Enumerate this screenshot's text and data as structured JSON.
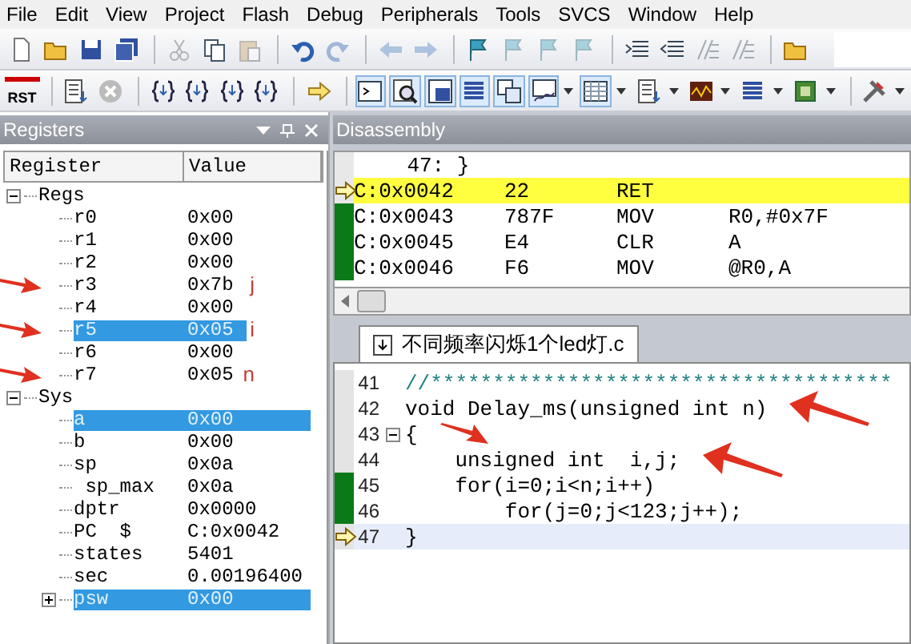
{
  "menu": [
    "File",
    "Edit",
    "View",
    "Project",
    "Flash",
    "Debug",
    "Peripherals",
    "Tools",
    "SVCS",
    "Window",
    "Help"
  ],
  "toolbar_file": [
    {
      "kind": "new-file",
      "disabled": false
    },
    {
      "kind": "folder",
      "disabled": false
    },
    {
      "kind": "save",
      "disabled": false
    },
    {
      "kind": "save-all",
      "disabled": false
    },
    {
      "kind": "sep"
    },
    {
      "kind": "scissors",
      "disabled": true
    },
    {
      "kind": "copy",
      "disabled": false
    },
    {
      "kind": "paste",
      "disabled": true
    },
    {
      "kind": "sep"
    },
    {
      "kind": "undo",
      "disabled": false
    },
    {
      "kind": "redo",
      "disabled": true
    },
    {
      "kind": "sep"
    },
    {
      "kind": "back",
      "disabled": true
    },
    {
      "kind": "forward",
      "disabled": true
    },
    {
      "kind": "sep"
    },
    {
      "kind": "flag",
      "disabled": false
    },
    {
      "kind": "flag",
      "disabled": true
    },
    {
      "kind": "flag",
      "disabled": true
    },
    {
      "kind": "flag",
      "disabled": true
    },
    {
      "kind": "sep"
    },
    {
      "kind": "indent",
      "disabled": false
    },
    {
      "kind": "outdent",
      "disabled": false
    },
    {
      "kind": "comment",
      "disabled": true
    },
    {
      "kind": "comment",
      "disabled": true
    },
    {
      "kind": "sep"
    },
    {
      "kind": "folder",
      "disabled": false
    }
  ],
  "toolbar_debug": [
    {
      "kind": "reset",
      "label": "RST",
      "on": false
    },
    {
      "kind": "sep"
    },
    {
      "kind": "document",
      "on": false
    },
    {
      "kind": "stop",
      "on": false
    },
    {
      "kind": "sep"
    },
    {
      "kind": "braces",
      "on": false
    },
    {
      "kind": "braces",
      "on": false
    },
    {
      "kind": "braces",
      "on": false
    },
    {
      "kind": "braces",
      "on": false
    },
    {
      "kind": "sep"
    },
    {
      "kind": "arrow",
      "on": false
    },
    {
      "kind": "sep"
    },
    {
      "kind": "terminal",
      "on": true
    },
    {
      "kind": "magnifier",
      "on": true
    },
    {
      "kind": "window",
      "on": true
    },
    {
      "kind": "list",
      "on": true
    },
    {
      "kind": "windows",
      "on": true
    },
    {
      "kind": "chart",
      "on": true,
      "dropdown": true
    },
    {
      "kind": "grid",
      "on": true,
      "dropdown": true
    },
    {
      "kind": "document",
      "on": false,
      "dropdown": true
    },
    {
      "kind": "wave",
      "on": false,
      "dropdown": true
    },
    {
      "kind": "list",
      "on": false,
      "dropdown": true
    },
    {
      "kind": "chip",
      "on": false,
      "dropdown": true
    },
    {
      "kind": "sep"
    },
    {
      "kind": "tools",
      "on": false,
      "dropdown": true
    }
  ],
  "registers": {
    "title": "Registers",
    "columns": [
      "Register",
      "Value"
    ],
    "tree": [
      {
        "name": "Regs",
        "expanded": true,
        "children": [
          {
            "name": "r0",
            "value": "0x00",
            "selected": false
          },
          {
            "name": "r1",
            "value": "0x00",
            "selected": false
          },
          {
            "name": "r2",
            "value": "0x00",
            "selected": false
          },
          {
            "name": "r3",
            "value": "0x7b",
            "selected": false,
            "arrow": true,
            "note": "j"
          },
          {
            "name": "r4",
            "value": "0x00",
            "selected": false
          },
          {
            "name": "r5",
            "value": "0x05",
            "selected": true,
            "arrow": true,
            "note": "i"
          },
          {
            "name": "r6",
            "value": "0x00",
            "selected": false
          },
          {
            "name": "r7",
            "value": "0x05",
            "selected": false,
            "arrow": true,
            "note": "n"
          }
        ]
      },
      {
        "name": "Sys",
        "expanded": true,
        "children": [
          {
            "name": "a",
            "value": "0x00",
            "selected": true
          },
          {
            "name": "b",
            "value": "0x00",
            "selected": false
          },
          {
            "name": "sp",
            "value": "0x0a",
            "selected": false
          },
          {
            "name": " sp_max",
            "value": "0x0a",
            "selected": false
          },
          {
            "name": "dptr",
            "value": "0x0000",
            "selected": false
          },
          {
            "name": "PC  $",
            "value": "C:0x0042",
            "selected": false
          },
          {
            "name": "states",
            "value": "5401",
            "selected": false
          },
          {
            "name": "sec",
            "value": "0.00196400",
            "selected": false
          },
          {
            "name": "psw",
            "value": "0x00",
            "selected": true,
            "expanded": false
          }
        ]
      }
    ]
  },
  "disassembly": {
    "title": "Disassembly",
    "lines": [
      {
        "kind": "source",
        "text": "    47: }",
        "current": false,
        "covered": false
      },
      {
        "kind": "asm",
        "address": "C:0x0042",
        "code": "22",
        "mnemonic": "RET",
        "current": true,
        "covered": false
      },
      {
        "kind": "asm",
        "address": "C:0x0043",
        "code": "787F",
        "mnemonic": "MOV",
        "operand": "R0,#0x7F",
        "current": false,
        "covered": true
      },
      {
        "kind": "asm",
        "address": "C:0x0045",
        "code": "E4",
        "mnemonic": "CLR",
        "operand": "A",
        "current": false,
        "covered": true
      },
      {
        "kind": "asm",
        "address": "C:0x0046",
        "code": "F6",
        "mnemonic": "MOV",
        "operand": "@R0,A",
        "current": false,
        "covered": true
      }
    ]
  },
  "editor": {
    "tabs": [
      {
        "label": "不同频率闪烁1个led灯.c",
        "selected": true
      }
    ],
    "lines": [
      {
        "number": "41",
        "text": "//*************************************",
        "kind": "comment",
        "current": false,
        "covered": false
      },
      {
        "number": "42",
        "text": "void Delay_ms(unsigned int n)",
        "kind": "code",
        "current": false,
        "covered": false,
        "annotation": {
          "kind": "arrow-left"
        }
      },
      {
        "number": "43",
        "text": "{",
        "kind": "code",
        "current": false,
        "covered": false,
        "fold": true,
        "annotation": {
          "kind": "arrow-down-right"
        }
      },
      {
        "number": "44",
        "text": "    unsigned int  i,j;",
        "kind": "code",
        "current": false,
        "covered": false,
        "annotation": {
          "kind": "arrow-left"
        }
      },
      {
        "number": "45",
        "text": "    for(i=0;i<n;i++)",
        "kind": "code",
        "current": false,
        "covered": true
      },
      {
        "number": "46",
        "text": "        for(j=0;j<123;j++);",
        "kind": "code",
        "current": false,
        "covered": true
      },
      {
        "number": "47",
        "text": "}",
        "kind": "code",
        "current": true,
        "covered": false
      }
    ]
  }
}
